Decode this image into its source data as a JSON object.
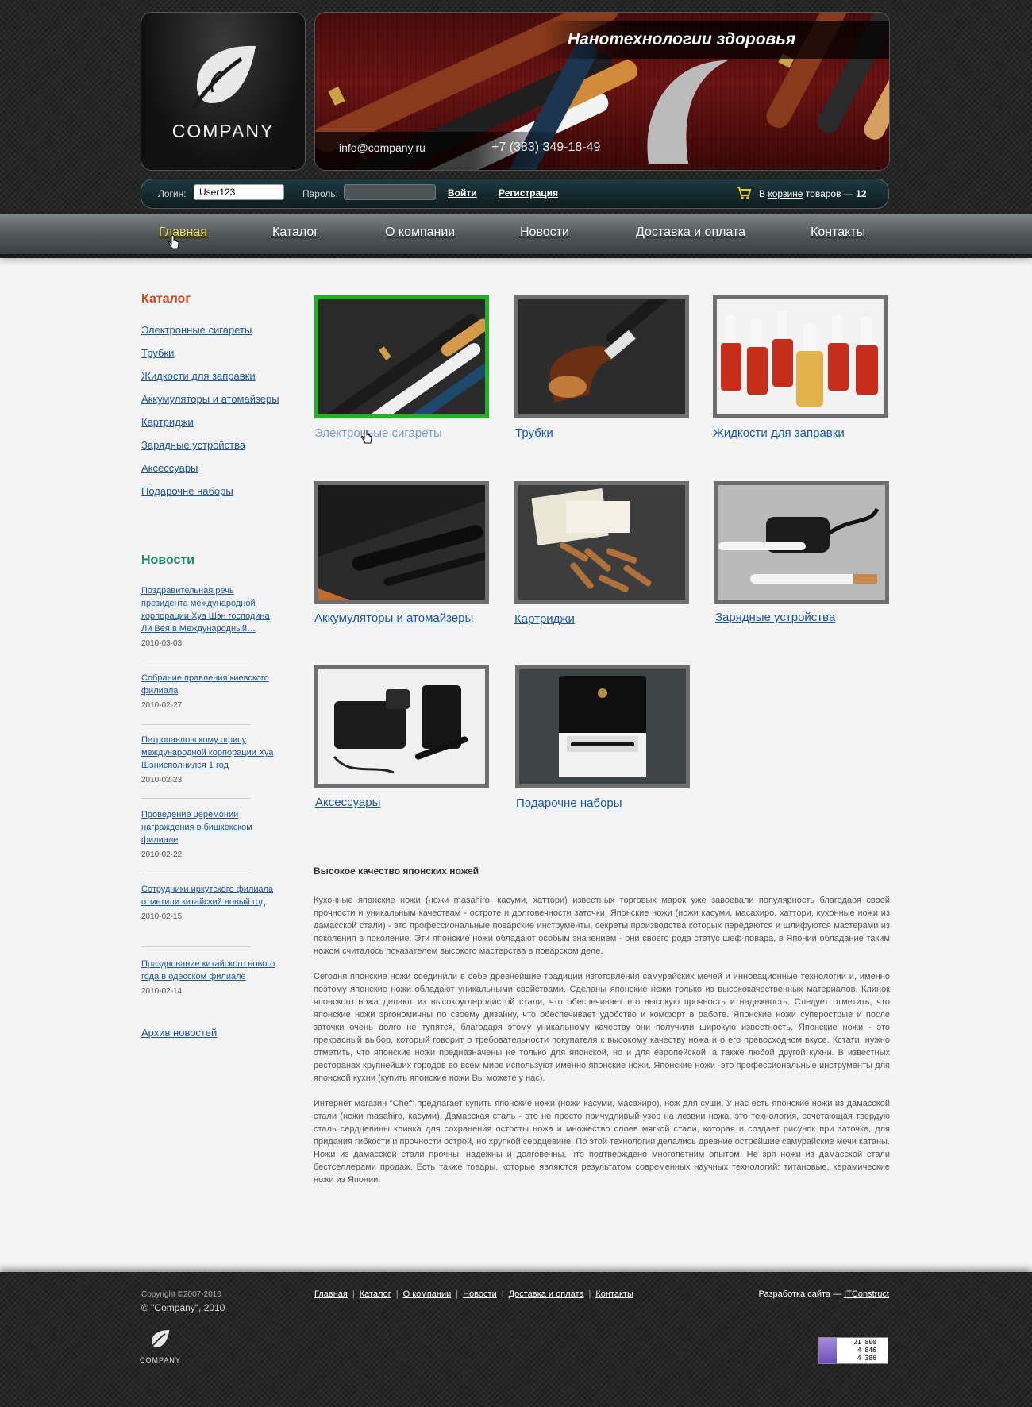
{
  "header": {
    "logo_text": "COMPANY",
    "banner_title": "Нанотехнологии здоровья",
    "email": "info@company.ru",
    "phone": "+7 (383) 349-18-49"
  },
  "loginbar": {
    "login_label": "Логин:",
    "login_value": "User123",
    "password_label": "Пароль:",
    "enter_label": "Войти",
    "register_label": "Регистрация",
    "cart_prefix": "В",
    "cart_link": "корзине",
    "cart_middle": "товаров —",
    "cart_count": "12"
  },
  "nav": {
    "items": [
      {
        "label": "Главная"
      },
      {
        "label": "Каталог"
      },
      {
        "label": "О компании"
      },
      {
        "label": "Новости"
      },
      {
        "label": "Доставка и оплата"
      },
      {
        "label": "Контакты"
      }
    ],
    "active_index": 0,
    "active_color": "#f5d84a"
  },
  "sidebar": {
    "catalog_title": "Каталог",
    "catalog_items": [
      "Электронные сигареты",
      "Трубки",
      "Жидкости для заправки",
      "Аккумуляторы и атомайзеры",
      "Картриджи",
      "Зарядные устройства",
      "Аксессуары",
      "Подарочне наборы"
    ],
    "news_title": "Новости",
    "news": [
      {
        "title": "Поздравительная речь президента международной корпорации Хуа Шэн господина Ли Вея в Международный…",
        "date": "2010-03-03"
      },
      {
        "title": "Собрание правления киевского филиала",
        "date": "2010-02-27"
      },
      {
        "title": "Петропавловскому офису международной корпорации Хуа Шэнисполнился 1 год",
        "date": "2010-02-23"
      },
      {
        "title": "Проведение церемонии награждения в бишкекском филиале",
        "date": "2010-02-22"
      },
      {
        "title": "Сотрудники иркутского филиала отметили китайский новый год",
        "date": "2010-02-15"
      },
      {
        "title": "Празднование китайского нового года в одесском филиале",
        "date": "2010-02-14"
      }
    ],
    "archive_label": "Архив новостей"
  },
  "products": [
    {
      "label": "Электронные сигареты",
      "image": "e-cigarettes-photo"
    },
    {
      "label": "Трубки",
      "image": "pipe-photo"
    },
    {
      "label": "Жидкости для заправки",
      "image": "liquid-bottles-photo"
    },
    {
      "label": "Аккумуляторы и атомайзеры",
      "image": "battery-photo"
    },
    {
      "label": "Картриджи",
      "image": "cartridges-photo"
    },
    {
      "label": "Зарядные устройства",
      "image": "charger-photo"
    },
    {
      "label": "Аксессуары",
      "image": "accessories-photo"
    },
    {
      "label": "Подарочне наборы",
      "image": "gift-box-photo"
    }
  ],
  "article": {
    "title": "Высокое качество японских ножей",
    "paragraphs": [
      "Кухонные японские ножи (ножи masahiro, касуми, хаттори) известных торговых марок уже завоевали популярность благодаря своей прочности и уникальным качествам - остроте и долговечности заточки. Японские ножи (ножи касуми, масахиро, хаттори, кухонные ножи из дамасской стали) - это профессиональные поварские инструменты, секреты производства которых передаются и шлифуются мастерами из поколения в поколение. Эти японские ножи обладают особым значением - они своего рода статус шеф-повара, в Японии обладание таким ножом считалось показателем высокого мастерства в поварском деле.",
      "Сегодня японские ножи соединили в себе древнейшие традиции изготовления самурайских мечей и инновационные технологии и, именно поэтому японские ножи обладают уникальными свойствами. Сделаны японские ножи только из высококачественных материалов. Клинок японского ножа делают из высокоуглеродистой стали, что обеспечивает его высокую прочность и надежность. Следует отметить, что японские ножи эргономичны по своему дизайну, что обеспечивает удобство и комфорт в работе. Японские ножи суперострые и после заточки очень долго не тупятся, благодаря этому уникальному качеству они получили широкую известность. Японские ножи - это прекрасный выбор, который говорит о требовательности покупателя к высокому качеству ножа и о его превосходном вкусе. Кстати, нужно отметить, что японские ножи предназначены не только для японской, но и для европейской, а также любой другой кухни. В известных ресторанах крупнейших городов во всем мире используют именно японские ножи. Японские ножи -это профессиональные инструменты для японской кухни (купить японские ножи Вы можете у нас).",
      "Интернет магазин \"Chef\" предлагает купить японские ножи (ножи касуми, масахиро), нож для суши. У нас есть японские ножи из дамасской стали (ножи masahiro, касуми). Дамасская сталь - это не просто причудливый узор на лезвии ножа, это технология, сочетающая твердую сталь сердцевины клинка для сохранения остроты ножа и множество слоев мягкой стали, которая и создает рисунок при заточке, для придания гибкости и прочности острой, но хрупкой сердцевине. По этой технологии делались древние острейшие самурайские мечи катаны. Ножи из дамасской стали прочны, надежны и долговечны, что подтверждено многолетним опытом. Не зря ножи из дамасской стали бестселлерами продаж. Есть также товары, которые являются результатом современных научных технологий: титановые, керамические ножи из Японии."
    ]
  },
  "footer": {
    "copyright_line": "Copyright ©2007-2010",
    "company_line": "© \"Company\", 2010",
    "nav": [
      "Главная",
      "Каталог",
      "О компании",
      "Новости",
      "Доставка и оплата",
      "Контакты"
    ],
    "dev_prefix": "Разработка сайта —",
    "dev_link": "ITConstruct",
    "logo_text": "COMPANY",
    "counter": [
      "21 800",
      "4 846",
      "4 386"
    ]
  }
}
